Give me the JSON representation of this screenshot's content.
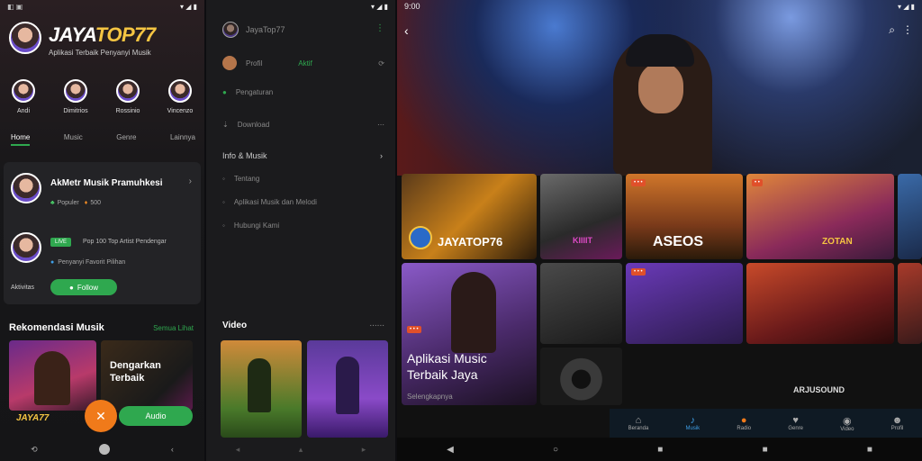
{
  "screen1": {
    "status_time": "",
    "brand_main": "JAYA",
    "brand_accent": "TOP77",
    "tagline": "Aplikasi Terbaik Penyanyi Musik",
    "stories": [
      "Andi",
      "Dimitrios",
      "Rossinio",
      "Vincenzo"
    ],
    "tabs": [
      "Home",
      "Music",
      "Genre",
      "Lainnya"
    ],
    "card": {
      "title": "AkMetr Musik Pramuhkesi",
      "meta1": "Populer",
      "meta2": "500",
      "badge": "LIVE",
      "line2": "Pop 100 Top Artist Pendengar",
      "line3": "Penyanyi Favorit Pilihan",
      "footer_label": "Aktivitas",
      "follow_label": "Follow"
    },
    "section_title": "Rekomendasi Musik",
    "section_link": "Semua Lihat",
    "promo_title_1": "Dengarkan",
    "promo_title_2": "Terbaik",
    "promo_badge": "JAYA77",
    "action_label": "Audio"
  },
  "screen2": {
    "header_title": "JayaTop77",
    "rows": [
      {
        "label": "Profil",
        "value": "Aktif"
      },
      {
        "label": "Pengaturan",
        "value": ""
      },
      {
        "label": "Download",
        "value": ""
      }
    ],
    "section_label": "Info & Musik",
    "links": [
      "Tentang",
      "Aplikasi Musik dan Melodi",
      "Hubungi Kami"
    ],
    "videos_label": "Video",
    "videos_more": "......"
  },
  "screen3": {
    "time": "9:00",
    "tiles": [
      {
        "text": "JAYATOP76"
      },
      {
        "text": "KIIIIT"
      },
      {
        "text": "ASEOS"
      },
      {
        "text": "ZOTAN"
      },
      {
        "text": ""
      },
      {
        "text": ""
      },
      {
        "text": ""
      },
      {
        "text": ""
      },
      {
        "text": ""
      }
    ],
    "feature_title_1": "Aplikasi Music",
    "feature_title_2": "Terbaik Jaya",
    "feature_sub": "Selengkapnya",
    "right_label": "ARJUSOUND",
    "nav": [
      "Beranda",
      "Musik",
      "Radio",
      "Genre",
      "Video",
      "Profil"
    ]
  }
}
